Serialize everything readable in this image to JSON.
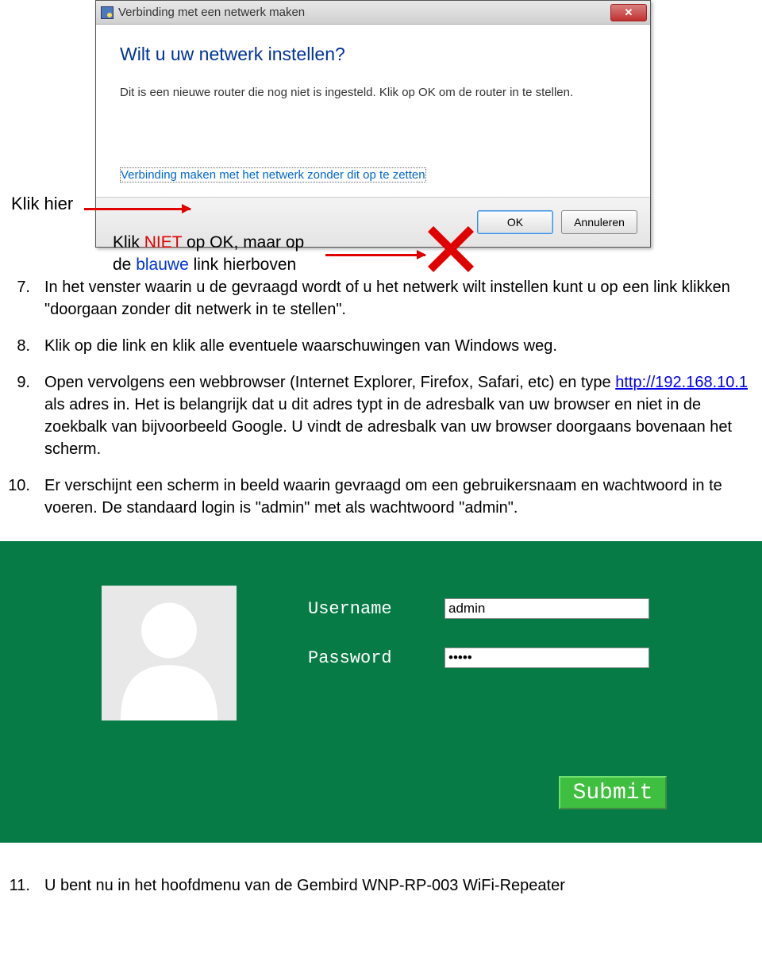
{
  "dialog": {
    "title": "Verbinding met een netwerk maken",
    "heading": "Wilt u uw netwerk instellen?",
    "body_text": "Dit is een nieuwe router die nog niet is ingesteld. Klik op OK om de router in te stellen.",
    "link_text": "Verbinding maken met het netwerk zonder dit op te zetten",
    "ok_label": "OK",
    "cancel_label": "Annuleren",
    "close_glyph": "✕"
  },
  "annotations": {
    "klik_hier": "Klik hier",
    "callout_prefix": "Klik ",
    "callout_niet": "NIET",
    "callout_mid": " op OK, maar op",
    "callout_line2_pre": "de ",
    "callout_blauwe": "blauwe",
    "callout_line2_post": " link hierboven"
  },
  "steps": {
    "s7": {
      "num": "7.",
      "text": "In het venster waarin u de gevraagd wordt of u het netwerk wilt instellen kunt u op een link klikken \"doorgaan zonder dit netwerk in te stellen\"."
    },
    "s8": {
      "num": "8.",
      "text": "Klik op die link en klik alle eventuele waarschuwingen van Windows weg."
    },
    "s9": {
      "num": "9.",
      "pre": "Open vervolgens een webbrowser (Internet Explorer, Firefox, Safari, etc) en type ",
      "link": "http://192.168.10.1",
      "post": " als adres in. Het is belangrijk dat u dit adres typt in de adresbalk van uw browser en niet in de zoekbalk van bijvoorbeeld Google. U vindt de adresbalk van uw browser doorgaans bovenaan het scherm."
    },
    "s10": {
      "num": "10.",
      "text": "Er verschijnt een scherm in beeld waarin gevraagd om een gebruikersnaam en wachtwoord in te voeren. De standaard login is \"admin\" met als wachtwoord \"admin\"."
    },
    "s11": {
      "num": "11.",
      "text": "U bent nu in het hoofdmenu van de Gembird WNP-RP-003 WiFi-Repeater"
    }
  },
  "login": {
    "username_label": "Username",
    "password_label": "Password",
    "username_value": "admin",
    "password_value": "•••••",
    "submit_label": "Submit"
  }
}
